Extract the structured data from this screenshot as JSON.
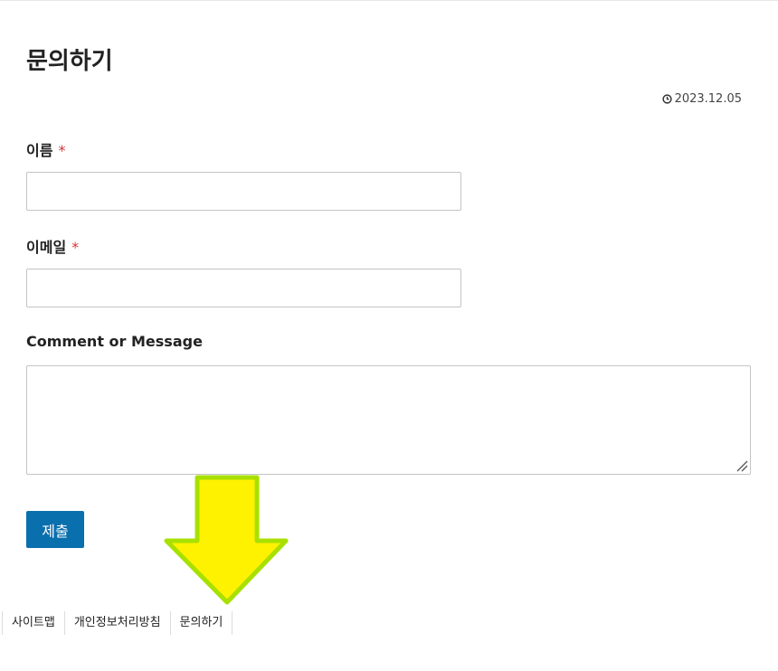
{
  "page": {
    "title": "문의하기",
    "date": "2023.12.05"
  },
  "form": {
    "name_label": "이름",
    "email_label": "이메일",
    "required_mark": "*",
    "message_label": "Comment or Message",
    "name_value": "",
    "email_value": "",
    "message_value": "",
    "submit_label": "제출"
  },
  "footer": {
    "links": [
      {
        "label": "사이트맵"
      },
      {
        "label": "개인정보처리방침"
      },
      {
        "label": "문의하기"
      }
    ]
  },
  "icons": {
    "date_icon": "clock-icon",
    "overlay_icon": "arrow-down-icon"
  },
  "colors": {
    "accent": "#0a6fad",
    "required": "#d63638",
    "arrow_fill": "#fff200",
    "arrow_stroke": "#a8e000"
  }
}
